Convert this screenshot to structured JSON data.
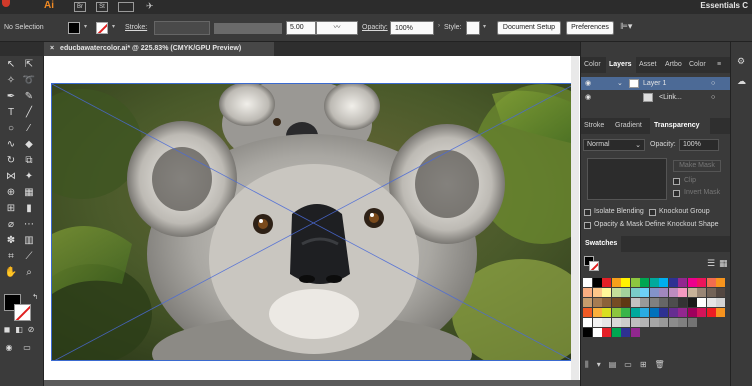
{
  "app": {
    "logo": "Ai",
    "bridge": "Br",
    "stock": "St",
    "workspace": "Essentials C"
  },
  "control": {
    "selection": "No Selection",
    "stroke_label": "Stroke:",
    "stroke_weight": "5.00",
    "opacity_label": "Opacity:",
    "opacity_value": "100%",
    "style_label": "Style:",
    "document_setup": "Document Setup",
    "preferences": "Preferences"
  },
  "document": {
    "tab_title": "educbawatercolor.ai* @ 225.83% (CMYK/GPU Preview)",
    "close": "×"
  },
  "layers_panel": {
    "tabs": [
      "Color",
      "Layers",
      "Asset",
      "Artbo",
      "Color"
    ],
    "active_tab": "Layers",
    "rows": [
      {
        "name": "Layer 1"
      },
      {
        "name": "<Link..."
      }
    ]
  },
  "transparency_panel": {
    "tabs": [
      "Stroke",
      "Gradient",
      "Transparency"
    ],
    "active_tab": "Transparency",
    "blend_mode": "Normal",
    "opacity_label": "Opacity:",
    "opacity_value": "100%",
    "make_mask": "Make Mask",
    "clip": "Clip",
    "invert_mask": "Invert Mask",
    "isolate_blending": "Isolate Blending",
    "knockout_group": "Knockout Group",
    "opacity_mask": "Opacity & Mask Define Knockout Shape"
  },
  "swatches_panel": {
    "title": "Swatches",
    "colors": {
      "row1": [
        "#ffffff",
        "#000000",
        "#e41f26",
        "#f6a01a",
        "#fff200",
        "#8dc63f",
        "#00a651",
        "#00a99d",
        "#00aeef",
        "#2e3192",
        "#92278f",
        "#ec008c",
        "#ed145b",
        "#f26c4f",
        "#f7941d"
      ],
      "row2": [
        "#f9ad81",
        "#fdc689",
        "#fff799",
        "#c4df9b",
        "#a3d39c",
        "#7accc8",
        "#6dcff6",
        "#8393ca",
        "#a187be",
        "#bd8cbf",
        "#f49ac1",
        "#c7b299",
        "#998675",
        "#736357",
        "#534741"
      ],
      "row3": [
        "#c69c6d",
        "#a67c52",
        "#8c6239",
        "#754c24",
        "#603913",
        "#c2c2c2",
        "#999999",
        "#808080",
        "#666666",
        "#4d4d4d",
        "#333333",
        "#1a1a1a",
        "#ffffff",
        "#e6e6e6",
        "#d4d4d4"
      ],
      "row4": [
        "#f15a24",
        "#fbb03b",
        "#d9e021",
        "#8cc63f",
        "#39b54a",
        "#00a99d",
        "#29abe2",
        "#0071bc",
        "#2e3192",
        "#662d91",
        "#93278f",
        "#9e005d",
        "#d4145a",
        "#ed1c24",
        "#f7931e"
      ],
      "gray_row": [
        "#ffffff",
        "#f2f2f2",
        "#e6e6e6",
        "#d9d9d9",
        "#cccccc",
        "#bfbfbf",
        "#b3b3b3",
        "#a6a6a6",
        "#999999",
        "#8c8c8c",
        "#808080",
        "#737373"
      ],
      "last_row": [
        "#000000",
        "#ffffff",
        "#e41f26",
        "#00a651",
        "#2e3192",
        "#92278f"
      ]
    }
  }
}
